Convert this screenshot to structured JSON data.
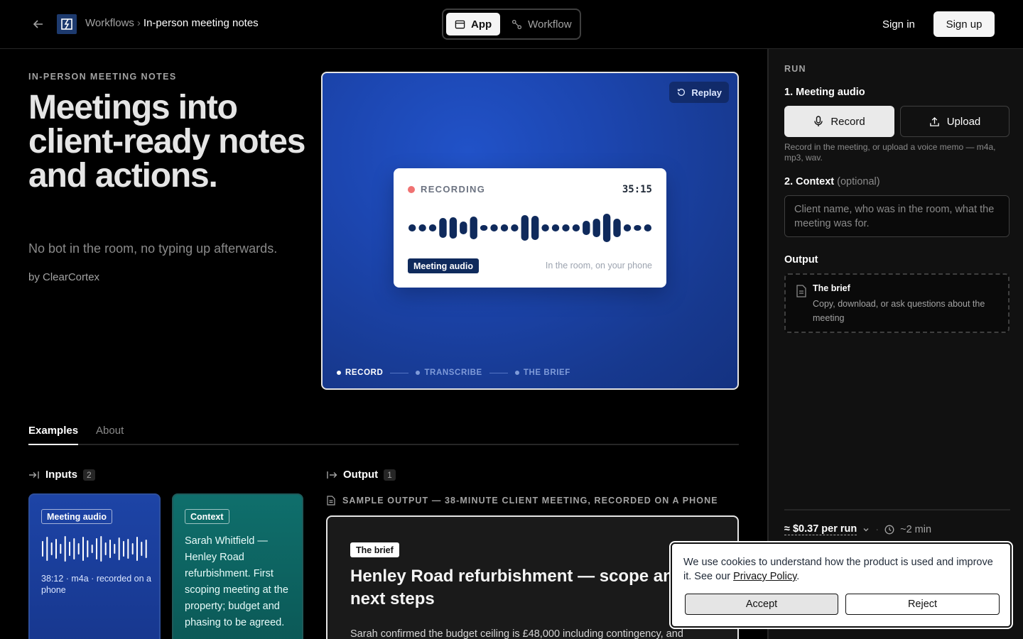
{
  "nav": {
    "breadcrumb_parent": "Workflows",
    "breadcrumb_separator": "›",
    "breadcrumb_current": "In-person meeting notes",
    "view_app": "App",
    "view_workflow": "Workflow",
    "sign_in": "Sign in",
    "sign_up": "Sign up"
  },
  "hero": {
    "eyebrow": "IN-PERSON MEETING NOTES",
    "title": "Meetings into client-ready notes and actions.",
    "subtitle": "No bot in the room, no typing up afterwards.",
    "byline": "by ClearCortex"
  },
  "preview": {
    "replay": "Replay",
    "recording_label": "RECORDING",
    "timer": "35:15",
    "audio_tag": "Meeting audio",
    "hint": "In the room, on your phone",
    "steps": [
      "RECORD",
      "TRANSCRIBE",
      "THE BRIEF"
    ],
    "active_step": 0
  },
  "tabs": {
    "examples": "Examples",
    "about": "About"
  },
  "inputs": {
    "heading": "Inputs",
    "count": "2",
    "audio_tag": "Meeting audio",
    "audio_meta": "38:12 · m4a · recorded on a phone",
    "context_tag": "Context",
    "context_text": "Sarah Whitfield — Henley Road refurbishment. First scoping meeting at the property; budget and phasing to be agreed."
  },
  "output": {
    "heading": "Output",
    "count": "1",
    "sample_label": "SAMPLE OUTPUT — 38-MINUTE CLIENT MEETING, RECORDED ON A PHONE",
    "brief_tag": "The brief",
    "brief_title": "Henley Road refurbishment — scope and next steps",
    "brief_body": "Sarah confirmed the budget ceiling is £48,000 including contingency, and"
  },
  "panel": {
    "run": "RUN",
    "step1": "1. Meeting audio",
    "record": "Record",
    "upload": "Upload",
    "help": "Record in the meeting, or upload a voice memo — m4a, mp3, wav.",
    "step2": "2. Context",
    "step2_optional": "(optional)",
    "context_placeholder": "Client name, who was in the room, what the meeting was for.",
    "output_label": "Output",
    "output_title": "The brief",
    "output_desc": "Copy, download, or ask questions about the meeting",
    "price": "≈ $0.37 per run",
    "time": "~2 min"
  },
  "cookie": {
    "text": "We use cookies to understand how the product is used and improve it. See our",
    "link": "Privacy Policy",
    "accept": "Accept",
    "reject": "Reject"
  },
  "colors": {
    "accent_blue": "#1c46b0",
    "context_teal": "#0f6f6c",
    "recording_red": "#f07272"
  }
}
